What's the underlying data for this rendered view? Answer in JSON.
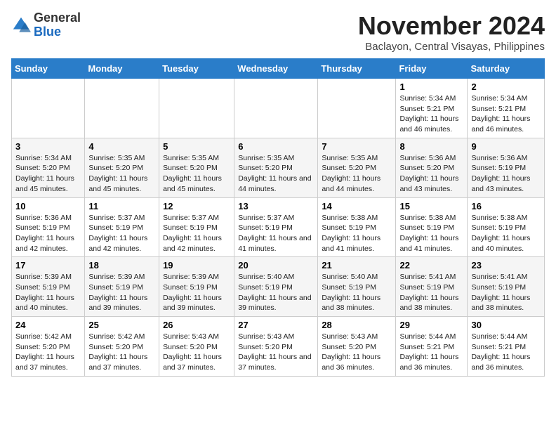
{
  "header": {
    "logo": {
      "general": "General",
      "blue": "Blue"
    },
    "month": "November 2024",
    "location": "Baclayon, Central Visayas, Philippines"
  },
  "weekdays": [
    "Sunday",
    "Monday",
    "Tuesday",
    "Wednesday",
    "Thursday",
    "Friday",
    "Saturday"
  ],
  "weeks": [
    [
      {
        "day": "",
        "info": ""
      },
      {
        "day": "",
        "info": ""
      },
      {
        "day": "",
        "info": ""
      },
      {
        "day": "",
        "info": ""
      },
      {
        "day": "",
        "info": ""
      },
      {
        "day": "1",
        "info": "Sunrise: 5:34 AM\nSunset: 5:21 PM\nDaylight: 11 hours and 46 minutes."
      },
      {
        "day": "2",
        "info": "Sunrise: 5:34 AM\nSunset: 5:21 PM\nDaylight: 11 hours and 46 minutes."
      }
    ],
    [
      {
        "day": "3",
        "info": "Sunrise: 5:34 AM\nSunset: 5:20 PM\nDaylight: 11 hours and 45 minutes."
      },
      {
        "day": "4",
        "info": "Sunrise: 5:35 AM\nSunset: 5:20 PM\nDaylight: 11 hours and 45 minutes."
      },
      {
        "day": "5",
        "info": "Sunrise: 5:35 AM\nSunset: 5:20 PM\nDaylight: 11 hours and 45 minutes."
      },
      {
        "day": "6",
        "info": "Sunrise: 5:35 AM\nSunset: 5:20 PM\nDaylight: 11 hours and 44 minutes."
      },
      {
        "day": "7",
        "info": "Sunrise: 5:35 AM\nSunset: 5:20 PM\nDaylight: 11 hours and 44 minutes."
      },
      {
        "day": "8",
        "info": "Sunrise: 5:36 AM\nSunset: 5:20 PM\nDaylight: 11 hours and 43 minutes."
      },
      {
        "day": "9",
        "info": "Sunrise: 5:36 AM\nSunset: 5:19 PM\nDaylight: 11 hours and 43 minutes."
      }
    ],
    [
      {
        "day": "10",
        "info": "Sunrise: 5:36 AM\nSunset: 5:19 PM\nDaylight: 11 hours and 42 minutes."
      },
      {
        "day": "11",
        "info": "Sunrise: 5:37 AM\nSunset: 5:19 PM\nDaylight: 11 hours and 42 minutes."
      },
      {
        "day": "12",
        "info": "Sunrise: 5:37 AM\nSunset: 5:19 PM\nDaylight: 11 hours and 42 minutes."
      },
      {
        "day": "13",
        "info": "Sunrise: 5:37 AM\nSunset: 5:19 PM\nDaylight: 11 hours and 41 minutes."
      },
      {
        "day": "14",
        "info": "Sunrise: 5:38 AM\nSunset: 5:19 PM\nDaylight: 11 hours and 41 minutes."
      },
      {
        "day": "15",
        "info": "Sunrise: 5:38 AM\nSunset: 5:19 PM\nDaylight: 11 hours and 41 minutes."
      },
      {
        "day": "16",
        "info": "Sunrise: 5:38 AM\nSunset: 5:19 PM\nDaylight: 11 hours and 40 minutes."
      }
    ],
    [
      {
        "day": "17",
        "info": "Sunrise: 5:39 AM\nSunset: 5:19 PM\nDaylight: 11 hours and 40 minutes."
      },
      {
        "day": "18",
        "info": "Sunrise: 5:39 AM\nSunset: 5:19 PM\nDaylight: 11 hours and 39 minutes."
      },
      {
        "day": "19",
        "info": "Sunrise: 5:39 AM\nSunset: 5:19 PM\nDaylight: 11 hours and 39 minutes."
      },
      {
        "day": "20",
        "info": "Sunrise: 5:40 AM\nSunset: 5:19 PM\nDaylight: 11 hours and 39 minutes."
      },
      {
        "day": "21",
        "info": "Sunrise: 5:40 AM\nSunset: 5:19 PM\nDaylight: 11 hours and 38 minutes."
      },
      {
        "day": "22",
        "info": "Sunrise: 5:41 AM\nSunset: 5:19 PM\nDaylight: 11 hours and 38 minutes."
      },
      {
        "day": "23",
        "info": "Sunrise: 5:41 AM\nSunset: 5:19 PM\nDaylight: 11 hours and 38 minutes."
      }
    ],
    [
      {
        "day": "24",
        "info": "Sunrise: 5:42 AM\nSunset: 5:20 PM\nDaylight: 11 hours and 37 minutes."
      },
      {
        "day": "25",
        "info": "Sunrise: 5:42 AM\nSunset: 5:20 PM\nDaylight: 11 hours and 37 minutes."
      },
      {
        "day": "26",
        "info": "Sunrise: 5:43 AM\nSunset: 5:20 PM\nDaylight: 11 hours and 37 minutes."
      },
      {
        "day": "27",
        "info": "Sunrise: 5:43 AM\nSunset: 5:20 PM\nDaylight: 11 hours and 37 minutes."
      },
      {
        "day": "28",
        "info": "Sunrise: 5:43 AM\nSunset: 5:20 PM\nDaylight: 11 hours and 36 minutes."
      },
      {
        "day": "29",
        "info": "Sunrise: 5:44 AM\nSunset: 5:21 PM\nDaylight: 11 hours and 36 minutes."
      },
      {
        "day": "30",
        "info": "Sunrise: 5:44 AM\nSunset: 5:21 PM\nDaylight: 11 hours and 36 minutes."
      }
    ]
  ]
}
